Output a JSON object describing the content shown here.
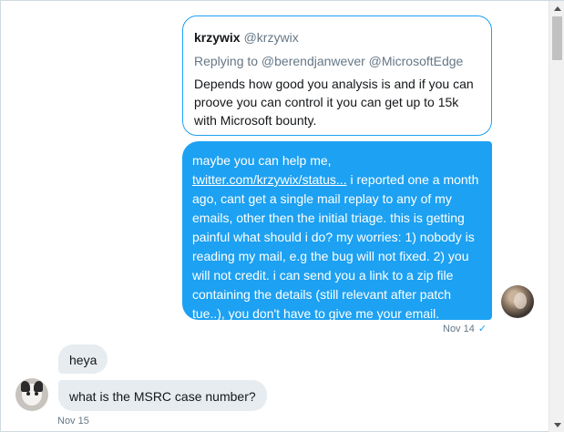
{
  "quote": {
    "name": "krzywix",
    "handle": "@krzywix",
    "replying_to": "Replying to @berendjanwever @MicrosoftEdge",
    "text": "Depends how good you analysis is and if you can proove you can control it you can get up to 15k with Microsoft bounty."
  },
  "outgoing_message": {
    "text_before_link": "maybe you can help me,",
    "link_text": "twitter.com/krzywix/status...",
    "text_after_link": " i reported one a month ago, cant get a single mail replay to any of my emails, other then the initial triage. this is getting painful what should i do? my worries: 1) nobody is reading my mail, e.g the bug will not fixed. 2) you will not credit. i can send you a link to a zip file containing the details (still relevant after patch tue..), you don't have to give me your email.",
    "timestamp": "Nov 14",
    "status_icon": "✓"
  },
  "incoming_messages": [
    {
      "text": "heya"
    },
    {
      "text": "what is the MSRC case number?"
    }
  ],
  "incoming_timestamp": "Nov 15",
  "colors": {
    "accent": "#1da1f2",
    "incoming_bubble": "#e6ecf0",
    "muted_text": "#657786"
  },
  "icons": {
    "read_receipt": "checkmark-icon",
    "scroll_up": "arrow-up-icon",
    "scroll_down": "arrow-down-icon"
  }
}
